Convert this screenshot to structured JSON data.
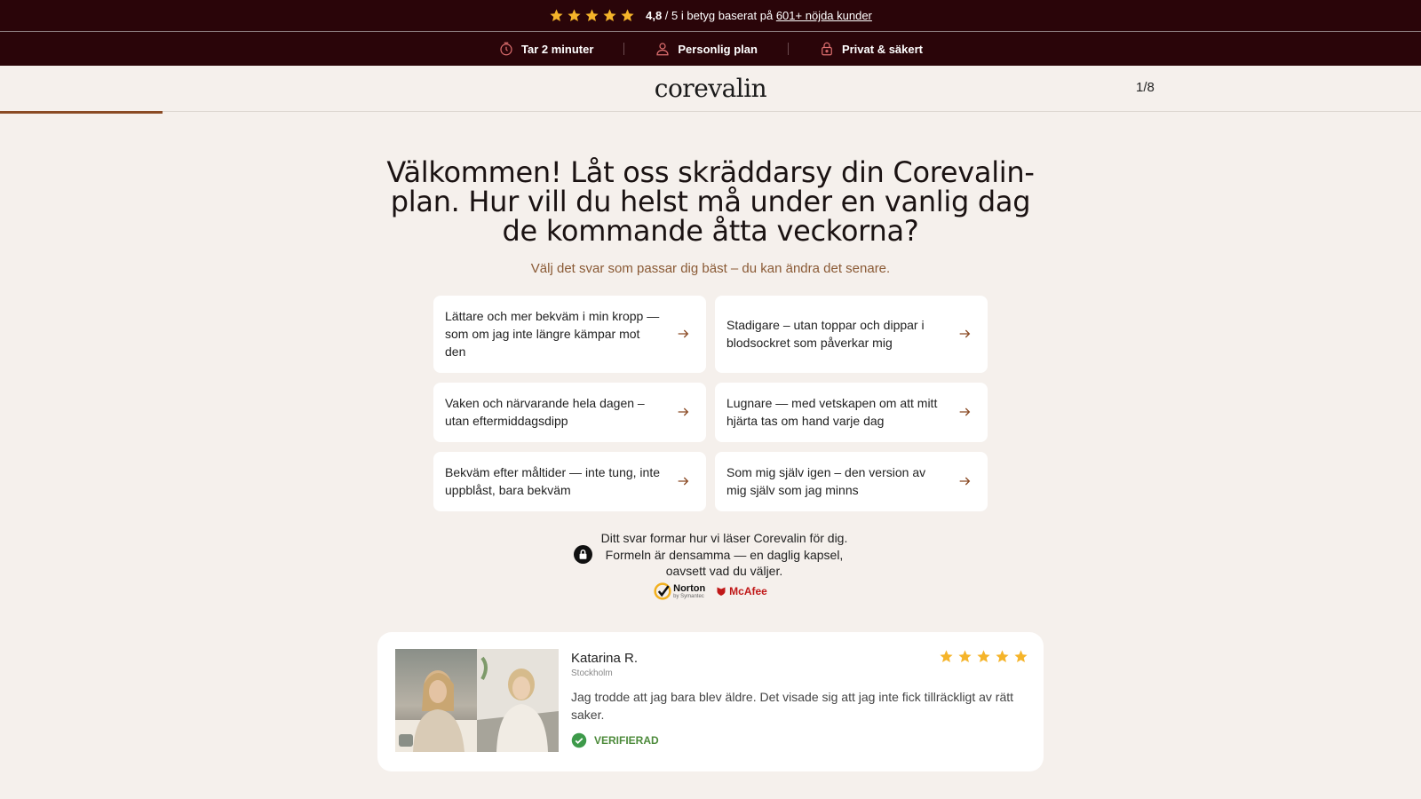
{
  "topbar": {
    "score": "4,8",
    "rest": " / 5 i betyg baserat på ",
    "link": "601+ nöjda kunder",
    "star_color": "#f5b42a"
  },
  "features": [
    {
      "icon": "clock-icon",
      "label": "Tar 2 minuter"
    },
    {
      "icon": "user-icon",
      "label": "Personlig plan"
    },
    {
      "icon": "lock-icon",
      "label": "Privat & säkert"
    }
  ],
  "header": {
    "logo": "corevalin",
    "step": "1/8",
    "progress": 0.125,
    "accent": "#8a4a24"
  },
  "question": {
    "title": "Välkommen! Låt oss skräddarsy din Corevalin-plan. Hur vill du helst må under en vanlig dag de kommande åtta veckorna?",
    "subtitle": "Välj det svar som passar dig bäst – du kan ändra det senare."
  },
  "options": [
    "Lättare och mer bekväm i min kropp — som om jag inte längre kämpar mot den",
    "Stadigare – utan toppar och dippar i blodsockret som påverkar mig",
    "Vaken och närvarande hela dagen – utan eftermiddagsdipp",
    "Lugnare — med vetskapen om att mitt hjärta tas om hand varje dag",
    "Bekväm efter måltider — inte tung, inte uppblåst, bara bekväm",
    "Som mig själv igen – den version av mig själv som jag minns"
  ],
  "assurance": {
    "line1": "Ditt svar formar hur vi läser Corevalin för dig.",
    "line2": "Formeln är densamma — en daglig kapsel,",
    "line3": "oavsett vad du väljer.",
    "norton": "Norton",
    "norton_sub": "by Symantec",
    "mcafee": "McAfee"
  },
  "review": {
    "name": "Katarina R.",
    "city": "Stockholm",
    "text": "Jag trodde att jag bara blev äldre. Det visade sig att jag inte fick tillräckligt av rätt saker.",
    "verified": "VERIFIERAD",
    "rating": 5,
    "verified_color": "#3d9a4a"
  }
}
